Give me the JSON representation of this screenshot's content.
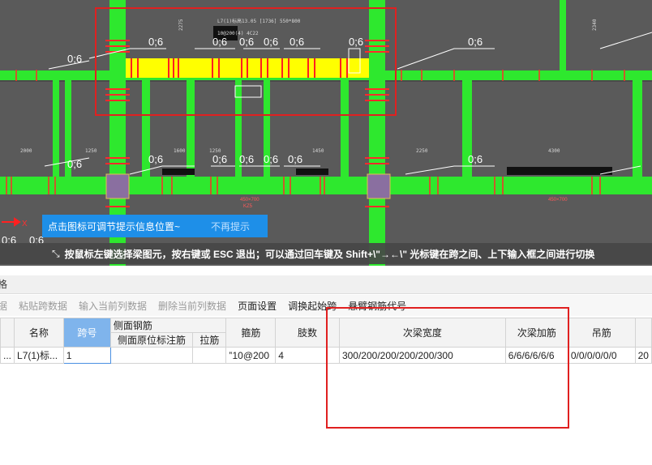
{
  "cad": {
    "beam_label_line1": "L7(1)标高13.05 [1736] 550*800",
    "beam_label_line2": "10@200(4) 4C22",
    "hint_text": "点击图标可调节提示信息位置~",
    "hint_dismiss": "不再提示",
    "status_text": "按鼠标左键选择梁图元，按右键或 ESC 退出；可以通过回车键及 Shift+\\\"→←\\\" 光标键在跨之间、上下输入框之间进行切换",
    "axis_label": "X",
    "dims_top": [
      "2275",
      "2340"
    ],
    "dims_mid": [
      "2000",
      "1250",
      "1600",
      "1250",
      "1450",
      "2250",
      "4300"
    ],
    "beam_sizes": [
      "450×700",
      "KZ5",
      "450×700"
    ],
    "annotation": "0;6"
  },
  "panel": {
    "title": "格",
    "toolbar": [
      {
        "label": "据",
        "enabled": false
      },
      {
        "label": "粘贴跨数据",
        "enabled": false
      },
      {
        "label": "输入当前列数据",
        "enabled": false
      },
      {
        "label": "删除当前列数据",
        "enabled": false
      },
      {
        "label": "页面设置",
        "enabled": true
      },
      {
        "label": "调换起始跨",
        "enabled": true
      },
      {
        "label": "悬臂钢筋代号",
        "enabled": true
      }
    ],
    "headers": {
      "name": "名称",
      "span": "跨号",
      "side_group": "侧面钢筋",
      "side_mark": "侧面原位标注筋",
      "tie": "拉筋",
      "stirrup": "箍筋",
      "legs": "肢数",
      "sec_width": "次梁宽度",
      "sec_add": "次梁加筋",
      "hanger": "吊筋"
    },
    "row": {
      "lead": "...",
      "name": "L7(1)标...",
      "span": "1",
      "side_mark": "",
      "tie": "",
      "stirrup": "‟10@200",
      "legs": "4",
      "sec_width": "300/200/200/200/200/300",
      "sec_add": "6/6/6/6/6/6",
      "hanger": "0/0/0/0/0/0",
      "extra": "20"
    }
  }
}
